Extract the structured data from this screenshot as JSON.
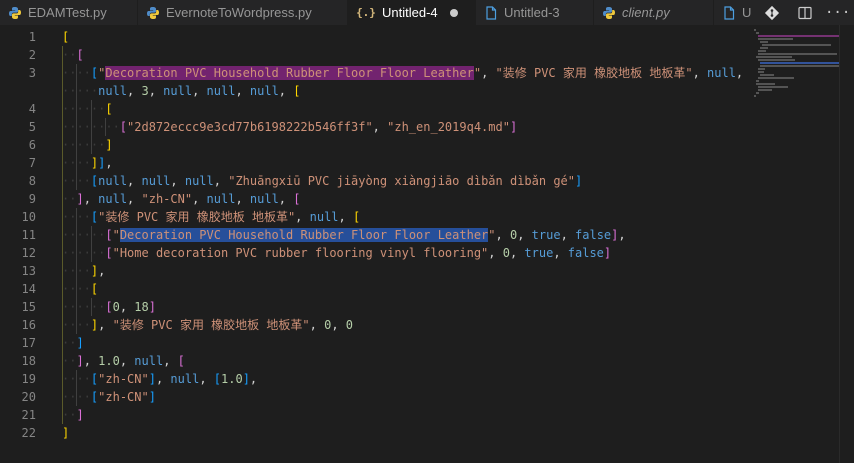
{
  "tabs": [
    {
      "label": "EDAMTest.py",
      "icon": "python-icon",
      "active": false,
      "italic": false
    },
    {
      "label": "EvernoteToWordpress.py",
      "icon": "python-icon",
      "active": false,
      "italic": false
    },
    {
      "label": "Untitled-4",
      "icon": "json-icon",
      "active": true,
      "italic": false,
      "dirty": true
    },
    {
      "label": "Untitled-3",
      "icon": "file-icon",
      "active": false,
      "italic": false
    },
    {
      "label": "client.py",
      "icon": "python-icon",
      "active": false,
      "italic": true
    },
    {
      "label": "U",
      "icon": "file-icon",
      "active": false,
      "italic": false
    }
  ],
  "json_icon_glyph": "{.}",
  "actions": [
    {
      "name": "git-compare-icon"
    },
    {
      "name": "split-editor-icon"
    },
    {
      "name": "more-actions-icon"
    }
  ],
  "more_glyph": "···",
  "colors": {
    "bracket_level1": "#ffd700",
    "bracket_level2": "#da70d6",
    "bracket_level3": "#179fff",
    "string": "#ce9178",
    "keyword": "#569cd6",
    "number": "#b5cea8",
    "find_highlight": "#72236f",
    "selection": "#264f9a"
  },
  "lines": [
    {
      "n": "1",
      "indent": 0,
      "tokens": [
        [
          "p-y",
          "["
        ]
      ]
    },
    {
      "n": "2",
      "indent": 1,
      "tokens": [
        [
          "p-p",
          "["
        ]
      ]
    },
    {
      "n": "3",
      "indent": 2,
      "tokens": [
        [
          "p-b",
          "["
        ],
        [
          "s",
          "\""
        ],
        [
          "s hl-find",
          "Decoration PVC Household Rubber Floor Floor Leather"
        ],
        [
          "s",
          "\""
        ],
        [
          "pu",
          ", "
        ],
        [
          "s",
          "\"装修 PVC 家用 橡胶地板 地板革\""
        ],
        [
          "pu",
          ", "
        ],
        [
          "kw",
          "null"
        ],
        [
          "pu",
          ","
        ]
      ]
    },
    {
      "n": "",
      "indent": 2,
      "wrap": true,
      "tokens": [
        [
          "kw",
          "null"
        ],
        [
          "pu",
          ", "
        ],
        [
          "n",
          "3"
        ],
        [
          "pu",
          ", "
        ],
        [
          "kw",
          "null"
        ],
        [
          "pu",
          ", "
        ],
        [
          "kw",
          "null"
        ],
        [
          "pu",
          ", "
        ],
        [
          "kw",
          "null"
        ],
        [
          "pu",
          ", "
        ],
        [
          "p-y",
          "["
        ]
      ]
    },
    {
      "n": "4",
      "indent": 3,
      "tokens": [
        [
          "p-y",
          "["
        ]
      ]
    },
    {
      "n": "5",
      "indent": 4,
      "tokens": [
        [
          "p-p",
          "["
        ],
        [
          "s",
          "\"2d872eccc9e3cd77b6198222b546ff3f\""
        ],
        [
          "pu",
          ", "
        ],
        [
          "s",
          "\"zh_en_2019q4.md\""
        ],
        [
          "p-p",
          "]"
        ]
      ]
    },
    {
      "n": "6",
      "indent": 3,
      "tokens": [
        [
          "p-y",
          "]"
        ]
      ]
    },
    {
      "n": "7",
      "indent": 2,
      "tokens": [
        [
          "p-y",
          "]"
        ],
        [
          "p-b",
          "]"
        ],
        [
          "pu",
          ","
        ]
      ]
    },
    {
      "n": "8",
      "indent": 2,
      "tokens": [
        [
          "p-b",
          "["
        ],
        [
          "kw",
          "null"
        ],
        [
          "pu",
          ", "
        ],
        [
          "kw",
          "null"
        ],
        [
          "pu",
          ", "
        ],
        [
          "kw",
          "null"
        ],
        [
          "pu",
          ", "
        ],
        [
          "s",
          "\"Zhuāngxiū PVC jiāyòng xiàngjiāo dìbǎn dìbǎn gé\""
        ],
        [
          "p-b",
          "]"
        ]
      ]
    },
    {
      "n": "9",
      "indent": 1,
      "tokens": [
        [
          "p-p",
          "]"
        ],
        [
          "pu",
          ", "
        ],
        [
          "kw",
          "null"
        ],
        [
          "pu",
          ", "
        ],
        [
          "s",
          "\"zh-CN\""
        ],
        [
          "pu",
          ", "
        ],
        [
          "kw",
          "null"
        ],
        [
          "pu",
          ", "
        ],
        [
          "kw",
          "null"
        ],
        [
          "pu",
          ", "
        ],
        [
          "p-p",
          "["
        ]
      ]
    },
    {
      "n": "10",
      "indent": 2,
      "tokens": [
        [
          "p-b",
          "["
        ],
        [
          "s",
          "\"装修 PVC 家用 橡胶地板 地板革\""
        ],
        [
          "pu",
          ", "
        ],
        [
          "kw",
          "null"
        ],
        [
          "pu",
          ", "
        ],
        [
          "p-y",
          "["
        ]
      ]
    },
    {
      "n": "11",
      "indent": 3,
      "tokens": [
        [
          "p-p",
          "["
        ],
        [
          "s",
          "\""
        ],
        [
          "s hl-sel",
          "Decoration PVC Household Rubber Floor Floor Leather"
        ],
        [
          "s",
          "\""
        ],
        [
          "pu",
          ", "
        ],
        [
          "n",
          "0"
        ],
        [
          "pu",
          ", "
        ],
        [
          "kw",
          "true"
        ],
        [
          "pu",
          ", "
        ],
        [
          "kw",
          "false"
        ],
        [
          "p-p",
          "]"
        ],
        [
          "pu",
          ","
        ]
      ]
    },
    {
      "n": "12",
      "indent": 3,
      "tokens": [
        [
          "p-p",
          "["
        ],
        [
          "s",
          "\"Home decoration PVC rubber flooring vinyl flooring\""
        ],
        [
          "pu",
          ", "
        ],
        [
          "n",
          "0"
        ],
        [
          "pu",
          ", "
        ],
        [
          "kw",
          "true"
        ],
        [
          "pu",
          ", "
        ],
        [
          "kw",
          "false"
        ],
        [
          "p-p",
          "]"
        ]
      ]
    },
    {
      "n": "13",
      "indent": 2,
      "tokens": [
        [
          "p-y",
          "]"
        ],
        [
          "pu",
          ","
        ]
      ]
    },
    {
      "n": "14",
      "indent": 2,
      "tokens": [
        [
          "p-y",
          "["
        ]
      ]
    },
    {
      "n": "15",
      "indent": 3,
      "tokens": [
        [
          "p-p",
          "["
        ],
        [
          "n",
          "0"
        ],
        [
          "pu",
          ", "
        ],
        [
          "n",
          "18"
        ],
        [
          "p-p",
          "]"
        ]
      ]
    },
    {
      "n": "16",
      "indent": 2,
      "tokens": [
        [
          "p-y",
          "]"
        ],
        [
          "pu",
          ", "
        ],
        [
          "s",
          "\"装修 PVC 家用 橡胶地板 地板革\""
        ],
        [
          "pu",
          ", "
        ],
        [
          "n",
          "0"
        ],
        [
          "pu",
          ", "
        ],
        [
          "n",
          "0"
        ]
      ]
    },
    {
      "n": "17",
      "indent": 1,
      "tokens": [
        [
          "p-b",
          "]"
        ]
      ]
    },
    {
      "n": "18",
      "indent": 1,
      "tokens": [
        [
          "p-p",
          "]"
        ],
        [
          "pu",
          ", "
        ],
        [
          "n",
          "1.0"
        ],
        [
          "pu",
          ", "
        ],
        [
          "kw",
          "null"
        ],
        [
          "pu",
          ", "
        ],
        [
          "p-p",
          "["
        ]
      ]
    },
    {
      "n": "19",
      "indent": 2,
      "tokens": [
        [
          "p-b",
          "["
        ],
        [
          "s",
          "\"zh-CN\""
        ],
        [
          "p-b",
          "]"
        ],
        [
          "pu",
          ", "
        ],
        [
          "kw",
          "null"
        ],
        [
          "pu",
          ", "
        ],
        [
          "p-b",
          "["
        ],
        [
          "n",
          "1.0"
        ],
        [
          "p-b",
          "]"
        ],
        [
          "pu",
          ","
        ]
      ]
    },
    {
      "n": "20",
      "indent": 2,
      "tokens": [
        [
          "p-b",
          "["
        ],
        [
          "s",
          "\"zh-CN\""
        ],
        [
          "p-b",
          "]"
        ]
      ]
    },
    {
      "n": "21",
      "indent": 1,
      "tokens": [
        [
          "p-p",
          "]"
        ]
      ]
    },
    {
      "n": "22",
      "indent": 0,
      "tokens": [
        [
          "p-y",
          "]"
        ]
      ]
    }
  ]
}
